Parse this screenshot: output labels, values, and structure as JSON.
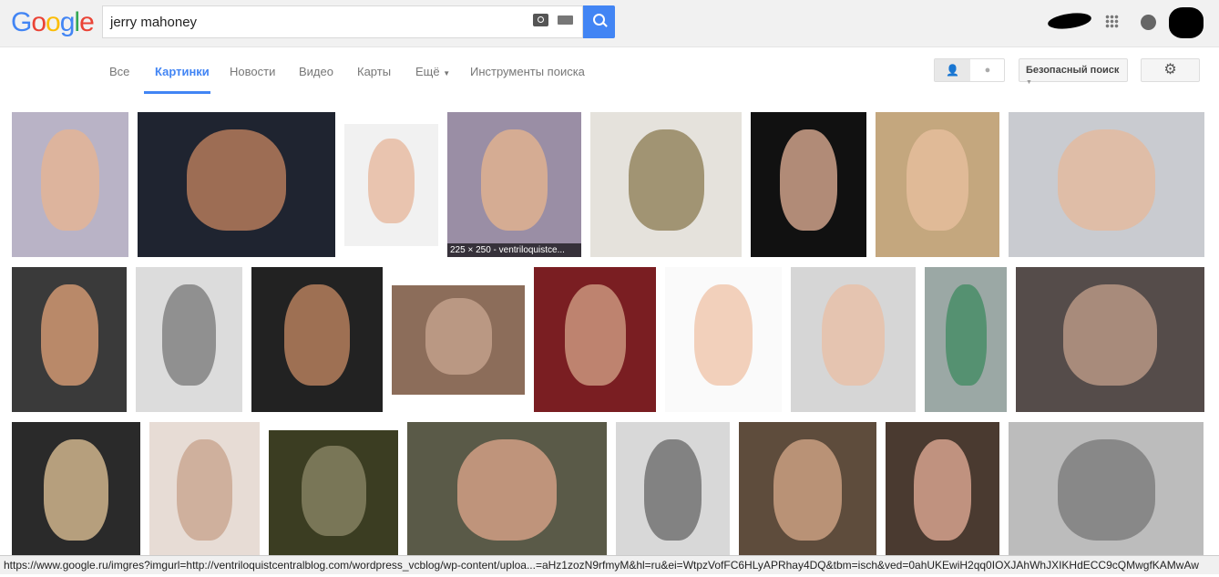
{
  "logo": "Google",
  "search": {
    "query": "jerry mahoney"
  },
  "nav": {
    "tabs": [
      "Все",
      "Картинки",
      "Новости",
      "Видео",
      "Карты",
      "Ещё",
      "Инструменты поиска"
    ],
    "active": 1
  },
  "safe_search": "Безопасный поиск",
  "accent": "#4285f4",
  "image_caption": "225 × 250 - ventriloquistce...",
  "images": [
    [
      {
        "bg": "#b9b3c6",
        "face": "#e9b48f"
      },
      {
        "bg": "#1f2430",
        "face": "#c88560"
      },
      {
        "bg": "#f1f1f1",
        "face": "#e6b498"
      },
      {
        "bg": "#9a8ea5",
        "face": "#e8b58e"
      },
      {
        "bg": "#e5e2dc",
        "face": "#8a7a50"
      },
      {
        "bg": "#111",
        "face": "#e7b49a"
      },
      {
        "bg": "#c4a77e",
        "face": "#e9c0a0"
      },
      {
        "bg": "#c9cbd0",
        "face": "#e6b89a"
      }
    ],
    [
      {
        "bg": "#3a3a3a",
        "face": "#e4a47a"
      },
      {
        "bg": "#dcdcdc",
        "face": "#777"
      },
      {
        "bg": "#222",
        "face": "#c88b64"
      },
      {
        "bg": "#8c6d5a",
        "face": "#c9a791"
      },
      {
        "bg": "#7a1e22",
        "face": "#d6a58a"
      },
      {
        "bg": "#fafafa",
        "face": "#efc2a6"
      },
      {
        "bg": "#d6d6d6",
        "face": "#e9bea3"
      },
      {
        "bg": "#9ba8a5",
        "face": "#3e8a60"
      },
      {
        "bg": "#554c4a",
        "face": "#c4a08c"
      }
    ],
    [
      {
        "bg": "#2a2a2a",
        "face": "#e6c79a"
      },
      {
        "bg": "#e7dcd5",
        "face": "#c7a18a"
      },
      {
        "bg": "#3b3d22",
        "face": "#8f8a6a"
      },
      {
        "bg": "#5a5a48",
        "face": "#e1a88c"
      },
      {
        "bg": "#d8d8d8",
        "face": "#666"
      },
      {
        "bg": "#5e4c3c",
        "face": "#d8aa8a"
      },
      {
        "bg": "#4a3a30",
        "face": "#e8b09a"
      },
      {
        "bg": "#bcbcbc",
        "face": "#777"
      }
    ]
  ],
  "status_url": "https://www.google.ru/imgres?imgurl=http://ventriloquistcentralblog.com/wordpress_vcblog/wp-content/uploa...=aHz1zozN9rfmyM&hl=ru&ei=WtpzVofFC6HLyAPRhay4DQ&tbm=isch&ved=0ahUKEwiH2qq0IOXJAhWhJXIKHdECC9cQMwgfKAMwAw"
}
